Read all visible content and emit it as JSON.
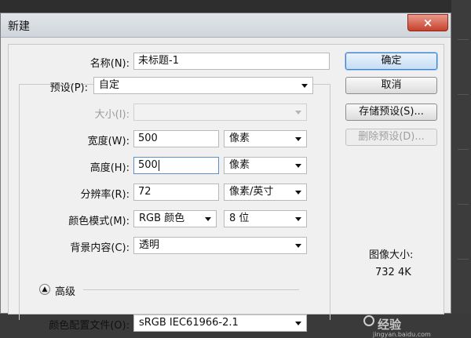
{
  "window": {
    "title": "新建",
    "close_icon": "×"
  },
  "form": {
    "name": {
      "label": "名称(N):",
      "value": "未标题-1"
    },
    "preset": {
      "label": "预设(P):",
      "value": "自定"
    },
    "size": {
      "label": "大小(I):",
      "value": ""
    },
    "width": {
      "label": "宽度(W):",
      "value": "500",
      "unit": "像素"
    },
    "height": {
      "label": "高度(H):",
      "value": "500",
      "unit": "像素"
    },
    "resolution": {
      "label": "分辨率(R):",
      "value": "72",
      "unit": "像素/英寸"
    },
    "color_mode": {
      "label": "颜色模式(M):",
      "value": "RGB 颜色",
      "depth": "8 位"
    },
    "background": {
      "label": "背景内容(C):",
      "value": "透明"
    },
    "advanced": {
      "label": "高级",
      "icon": "collapse-chevron-icon"
    },
    "color_profile": {
      "label": "颜色配置文件(O):",
      "value": "sRGB IEC61966-2.1"
    }
  },
  "buttons": {
    "ok": "确定",
    "cancel": "取消",
    "save_preset": "存储预设(S)...",
    "delete_preset": "删除预设(D)..."
  },
  "image_size": {
    "label": "图像大小:",
    "value": "732 4K"
  },
  "watermark": {
    "text": "经验",
    "sub": "jingyan.baidu.com"
  }
}
